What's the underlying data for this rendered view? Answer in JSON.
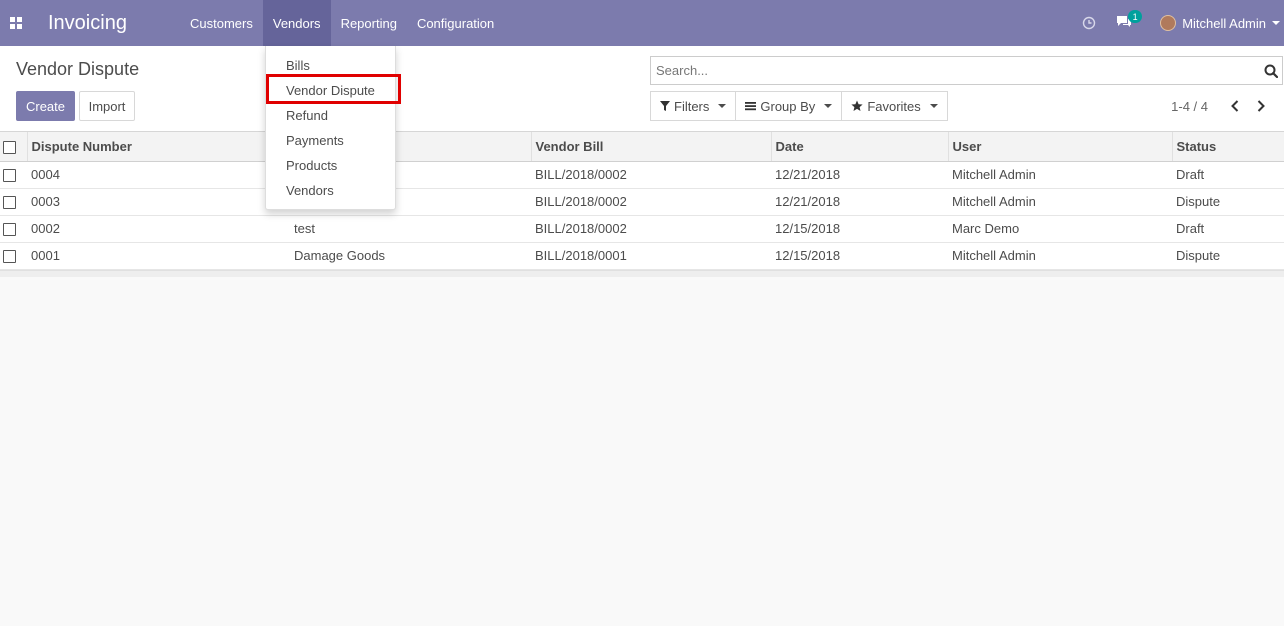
{
  "app": {
    "title": "Invoicing"
  },
  "nav": {
    "menus": [
      "Customers",
      "Vendors",
      "Reporting",
      "Configuration"
    ],
    "active_menu": "Vendors",
    "chat_count": "1",
    "user_name": "Mitchell Admin"
  },
  "dropdown": {
    "items": [
      "Bills",
      "Vendor Dispute",
      "Refund",
      "Payments",
      "Products",
      "Vendors"
    ],
    "highlighted": "Vendor Dispute"
  },
  "control": {
    "breadcrumb": "Vendor Dispute",
    "create_label": "Create",
    "import_label": "Import",
    "search_placeholder": "Search...",
    "filters_label": "Filters",
    "groupby_label": "Group By",
    "favorites_label": "Favorites",
    "pager_value": "1-4 / 4"
  },
  "table": {
    "columns": [
      "Dispute Number",
      "",
      "Vendor Bill",
      "Date",
      "User",
      "Status"
    ],
    "rows": [
      {
        "number": "0004",
        "name": "",
        "bill": "BILL/2018/0002",
        "date": "12/21/2018",
        "user": "Mitchell Admin",
        "status": "Draft"
      },
      {
        "number": "0003",
        "name": "",
        "bill": "BILL/2018/0002",
        "date": "12/21/2018",
        "user": "Mitchell Admin",
        "status": "Dispute"
      },
      {
        "number": "0002",
        "name": "test",
        "bill": "BILL/2018/0002",
        "date": "12/15/2018",
        "user": "Marc Demo",
        "status": "Draft"
      },
      {
        "number": "0001",
        "name": "Damage Goods",
        "bill": "BILL/2018/0001",
        "date": "12/15/2018",
        "user": "Mitchell Admin",
        "status": "Dispute"
      }
    ]
  },
  "colors": {
    "navbar": "#7c7bad",
    "navbar_active": "#65649a",
    "primary_button": "#7c7bad",
    "highlight_border": "#e00000",
    "badge": "#00a09d"
  }
}
